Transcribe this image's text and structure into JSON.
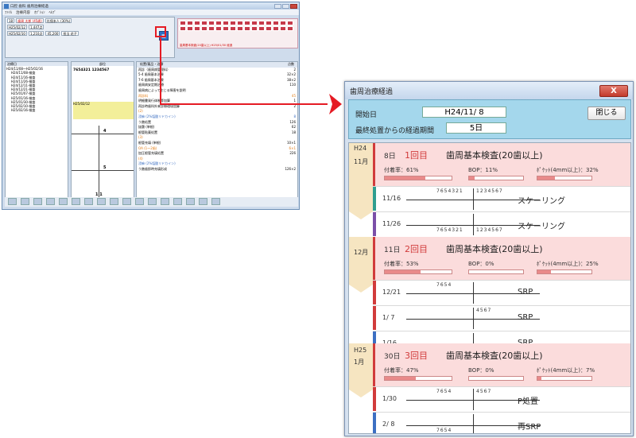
{
  "main_window": {
    "title": "口腔 歯科 歯周治療経過",
    "menu": [
      "ﾌｧｲﾙ",
      "治療内容",
      "ｵﾌﾟｼｮﾝ",
      "ﾍﾙﾌﾟ"
    ],
    "patient": {
      "id": "18",
      "name": "歯周 太郎 (45歳)",
      "insurance": "社保本人 (30%)",
      "date1": "H25/02/12",
      "amount1": "1,447点",
      "date2": "H25/02/10",
      "amount2": "1,210点",
      "total": "45,200",
      "doctor": "担当 花子"
    },
    "chart_link": "歯周基本検査(20歯以上) H25/01/30 経過",
    "tree_header": "治療日",
    "tree": [
      "H24/11/08〜H25/02/16",
      "H24/11/08-検査",
      "H24/11/16-検査",
      "H24/11/26-検査",
      "H24/12/11-検査",
      "H24/12/21-検査",
      "H25/01/07-検査",
      "H25/01/16-検査",
      "H25/01/30-検査",
      "H25/02/10-検査",
      "H25/02/16-検査"
    ],
    "center_header": "部位",
    "teeth_number": "7654321 1234567",
    "center_date": "H25/02/12",
    "center_marks": [
      "4",
      "5",
      "1 1"
    ],
    "right_header_left": "処置/薬品・治療",
    "right_header_right": "点数",
    "right_rows": [
      {
        "t": "再診（歯周病管理料）",
        "p": "2",
        "c": ""
      },
      {
        "t": "5-4 歯周基本治療",
        "p": "32×2",
        "c": ""
      },
      {
        "t": "7-6 歯周基本治療",
        "p": "38×2",
        "c": ""
      },
      {
        "t": "歯周病安定期治療",
        "p": "110",
        "c": ""
      },
      {
        "t": "歯周病によって生じる障害を説明",
        "p": "",
        "c": ""
      },
      {
        "t": "再診料",
        "p": "45",
        "c": "or"
      },
      {
        "t": "明細書発行体制等加算",
        "p": "1",
        "c": ""
      },
      {
        "t": "再診時歯科外来診療環境加算",
        "p": "2",
        "c": ""
      },
      {
        "t": "(2)",
        "p": "",
        "c": "or"
      },
      {
        "t": "浸麻 (2%塩酸リドカイン)",
        "p": "8",
        "c": "bl"
      },
      {
        "t": "う蝕処置",
        "p": "126",
        "c": ""
      },
      {
        "t": "抜髄 (単根)",
        "p": "62",
        "c": ""
      },
      {
        "t": "根管貼薬処置",
        "p": "18",
        "c": ""
      },
      {
        "t": "(3)",
        "p": "",
        "c": "or"
      },
      {
        "t": "根管充填 (単根)",
        "p": "10×1",
        "c": ""
      },
      {
        "t": "OA (1〜2歯)",
        "p": "6×1",
        "c": "or"
      },
      {
        "t": "加圧根管充填処置",
        "p": "226",
        "c": ""
      },
      {
        "t": "(4)",
        "p": "",
        "c": "or"
      },
      {
        "t": "浸麻 (2%塩酸リドカイン)",
        "p": "",
        "c": "bl"
      },
      {
        "t": "う蝕歯即時充填形成",
        "p": "126×2",
        "c": ""
      }
    ]
  },
  "popup": {
    "title": "歯周治療経過",
    "close_x": "X",
    "start_label": "開始日",
    "start_value": "H24/11/ 8",
    "elapsed_label": "最終処置からの経過期間",
    "elapsed_value": "5日",
    "close_button": "閉じる",
    "months": [
      {
        "year": "H24",
        "month": "11月"
      },
      {
        "year": "",
        "month": "12月"
      },
      {
        "year": "H25",
        "month": "1月"
      }
    ],
    "exams": [
      {
        "day": "8日",
        "count": "1回目",
        "name": "歯周基本検査(20歯以上)",
        "plaque": "付着率：61%",
        "bop": "BOP：11%",
        "pocket": "ﾎﾟｹｯﾄ(4mm以上)：32%",
        "plaque_v": 0.61,
        "bop_v": 0.11,
        "pocket_v": 0.32
      },
      {
        "day": "11日",
        "count": "2回目",
        "name": "歯周基本検査(20歯以上)",
        "plaque": "付着率：53%",
        "bop": "BOP：0%",
        "pocket": "ﾎﾟｹｯﾄ(4mm以上)：25%",
        "plaque_v": 0.53,
        "bop_v": 0,
        "pocket_v": 0.25
      },
      {
        "day": "30日",
        "count": "3回目",
        "name": "歯周基本検査(20歯以上)",
        "plaque": "付着率：47%",
        "bop": "BOP：0%",
        "pocket": "ﾎﾟｹｯﾄ(4mm以上)：7%",
        "plaque_v": 0.47,
        "bop_v": 0,
        "pocket_v": 0.07
      }
    ],
    "treatments": [
      {
        "date": "11/16",
        "ul": "7654321",
        "ur": "1234567",
        "ll": "",
        "lr": "",
        "name": "スケーリング",
        "color": "#2f9e8f"
      },
      {
        "date": "11/26",
        "ul": "",
        "ur": "",
        "ll": "7654321",
        "lr": "1234567",
        "name": "スケーリング",
        "color": "#7b4fa8"
      },
      {
        "date": "12/21",
        "ul": "7654",
        "ur": "",
        "ll": "",
        "lr": "",
        "name": "SRP",
        "color": "#d13b3b"
      },
      {
        "date": "1/ 7",
        "ul": "",
        "ur": "4567",
        "ll": "",
        "lr": "",
        "name": "SRP",
        "color": "#d13b3b"
      },
      {
        "date": "1/16",
        "ul": "",
        "ur": "",
        "ll": "7654",
        "lr": "",
        "name": "SRP",
        "color": "#3c6fc2"
      },
      {
        "date": "1/30",
        "ul": "7654",
        "ur": "4567",
        "ll": "",
        "lr": "",
        "name": "P処置",
        "color": "#d13b3b"
      },
      {
        "date": "2/ 8",
        "ul": "",
        "ur": "",
        "ll": "7654",
        "lr": "",
        "name": "再SRP",
        "color": "#3c6fc2"
      }
    ]
  },
  "colors": {
    "accent_red": "#e51b24",
    "exam_band": "#fbdcdc",
    "month_band": "#f6e5c1",
    "header_blue": "#a4d7ec"
  }
}
